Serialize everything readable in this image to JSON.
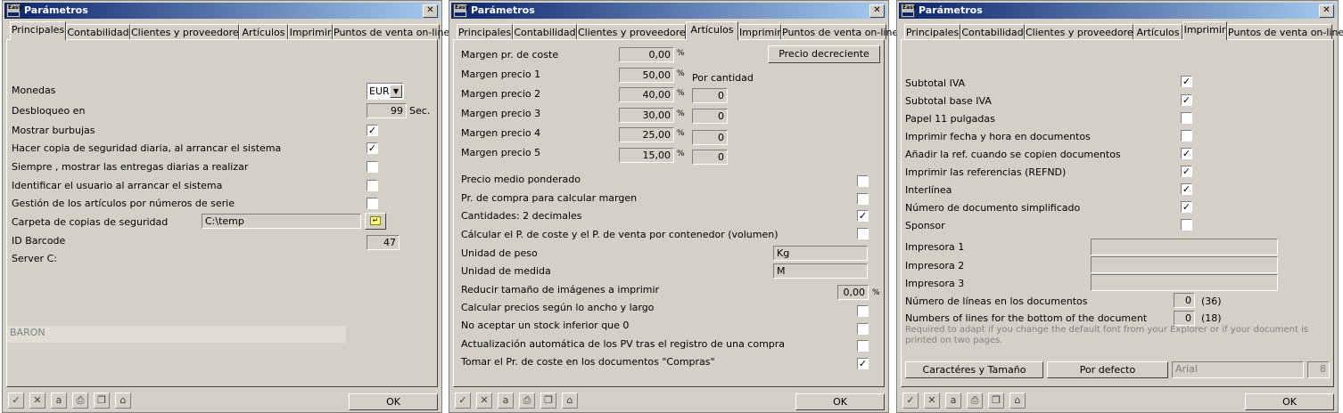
{
  "window_title": "Parámetros",
  "app_icon_text": "Easy",
  "close_glyph": "✕",
  "tabs": [
    "Principales",
    "Contabilidad",
    "Clientes y proveedores",
    "Artículos",
    "Imprimir",
    "Puntos de venta on-line"
  ],
  "ok_label": "OK",
  "toolbar_icons": [
    "check-icon",
    "cancel-icon",
    "font-icon",
    "print-icon",
    "copy-icon",
    "home-icon"
  ],
  "principales": {
    "monedas_label": "Monedas",
    "monedas_value": "EUR",
    "desbloqueo_label": "Desbloqueo en",
    "desbloqueo_value": "99",
    "desbloqueo_unit": "Sec.",
    "checks": [
      {
        "label": "Mostrar burbujas",
        "checked": "✓"
      },
      {
        "label": "Hacer copia de seguridad diaria, al arrancar el sistema",
        "checked": "✓"
      },
      {
        "label": "Siempre , mostrar las entregas diarias a realizar",
        "checked": ""
      },
      {
        "label": "Identificar el usuario al arrancar el sistema",
        "checked": ""
      },
      {
        "label": "Gestión de los artículos por números de serie",
        "checked": ""
      }
    ],
    "carpeta_label": "Carpeta de copias de seguridad",
    "carpeta_value": "C:\\temp",
    "barcode_label": "ID Barcode",
    "barcode_value": "47",
    "server_label": "Server C:",
    "footer_field": "BARON"
  },
  "articulos": {
    "margen_coste_label": "Margen pr. de coste",
    "margen_coste_value": "0,00",
    "percent": "%",
    "precio_decreciente_button": "Precio decreciente",
    "por_cantidad_label": "Por cantidad",
    "margins": [
      {
        "label": "Margen precio 1",
        "value": "50,00",
        "qty": ""
      },
      {
        "label": "Margen precio 2",
        "value": "40,00",
        "qty": "0"
      },
      {
        "label": "Margen precio 3",
        "value": "30,00",
        "qty": "0"
      },
      {
        "label": "Margen precio 4",
        "value": "25,00",
        "qty": "0"
      },
      {
        "label": "Margen precio 5",
        "value": "15,00",
        "qty": "0"
      }
    ],
    "checks_a": [
      {
        "label": "Precio medio ponderado",
        "checked": ""
      },
      {
        "label": "Pr. de compra para calcular margen",
        "checked": ""
      },
      {
        "label": "Cantidades: 2 decimales",
        "checked": "✓"
      },
      {
        "label": "Cálcular el P. de coste y el P. de venta por contenedor (volumen)",
        "checked": ""
      }
    ],
    "peso_label": "Unidad de peso",
    "peso_value": "Kg",
    "medida_label": "Unidad de medida",
    "medida_value": "M",
    "reducir_label": "Reducir tamaño de imágenes a imprimir",
    "reducir_value": "0,00",
    "checks_b": [
      {
        "label": "Calcular precios según lo ancho y largo",
        "checked": ""
      },
      {
        "label": "No aceptar un stock inferior que 0",
        "checked": ""
      },
      {
        "label": "Actualización automática de los PV tras el registro de una compra",
        "checked": ""
      },
      {
        "label": "Tomar el Pr. de coste en los documentos \"Compras\"",
        "checked": "✓"
      }
    ]
  },
  "imprimir": {
    "checks": [
      {
        "label": "Subtotal IVA",
        "checked": "✓"
      },
      {
        "label": "Subtotal base IVA",
        "checked": "✓"
      },
      {
        "label": "Papel 11 pulgadas",
        "checked": ""
      },
      {
        "label": "Imprimir fecha y hora en documentos",
        "checked": ""
      },
      {
        "label": "Añadir la ref. cuando se copien documentos",
        "checked": "✓"
      },
      {
        "label": "Imprimir las referencias (REFND)",
        "checked": "✓"
      },
      {
        "label": "Interlínea",
        "checked": "✓"
      },
      {
        "label": "Número de documento simplificado",
        "checked": "✓"
      },
      {
        "label": "Sponsor",
        "checked": ""
      }
    ],
    "printers": [
      "Impresora 1",
      "Impresora 2",
      "Impresora 3"
    ],
    "lineas_label": "Número de líneas en los documentos",
    "lineas_value": "0",
    "lineas_hint": "(36)",
    "bottom_label": "Numbers of lines for the bottom of the document",
    "bottom_value": "0",
    "bottom_hint": "(18)",
    "note": "Required to adapt if you change the default font from your Explorer or if your document is printed on two pages.",
    "caracteres_button": "Caractéres y Tamaño",
    "defecto_button": "Por defecto",
    "font_name": "Arial",
    "font_size": "8"
  }
}
